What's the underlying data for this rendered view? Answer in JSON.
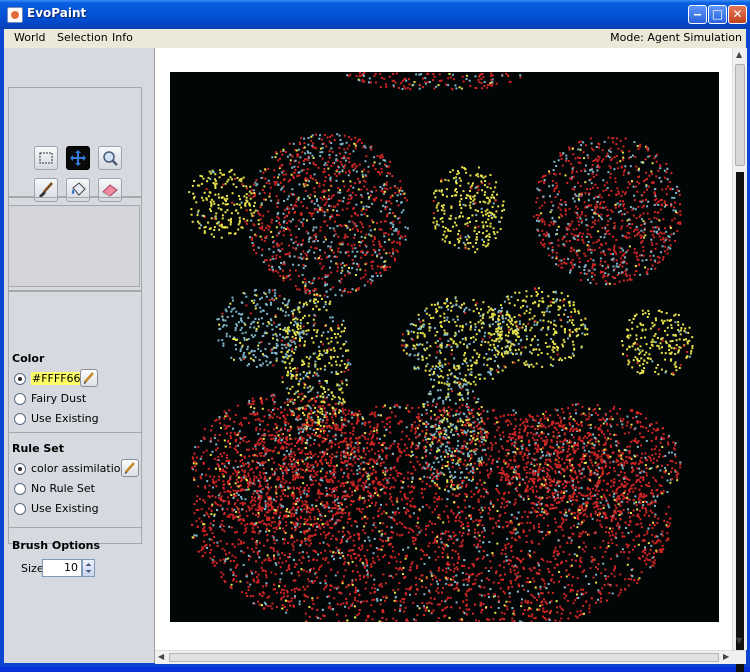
{
  "window": {
    "title": "EvoPaint"
  },
  "menu": {
    "items": [
      "World",
      "Selection",
      "Info"
    ],
    "mode": "Mode: Agent Simulation"
  },
  "playback": [
    "record-icon",
    "play-icon",
    "pause-icon",
    "stop-icon",
    "eject-icon"
  ],
  "tools": [
    "selection-tool-icon",
    "move-tool-icon",
    "zoom-tool-icon",
    "brush-tool-icon",
    "fill-tool-icon",
    "eraser-tool-icon",
    "picker-tool-icon"
  ],
  "color": {
    "title": "Color",
    "options": [
      "#FFFF66",
      "Fairy Dust",
      "Use Existing"
    ],
    "selected_index": 0,
    "swatch": "#ffff66"
  },
  "ruleset": {
    "title": "Rule Set",
    "options": [
      "color assimilation",
      "No Rule Set",
      "Use Existing"
    ],
    "selected_index": 0
  },
  "brush": {
    "title": "Brush Options",
    "size_label": "Size",
    "size_value": "10"
  },
  "colors": {
    "canvas_bg": "#030606",
    "red": "#d02525",
    "yellow": "#e8e34a",
    "blue": "#7fb6cc"
  }
}
